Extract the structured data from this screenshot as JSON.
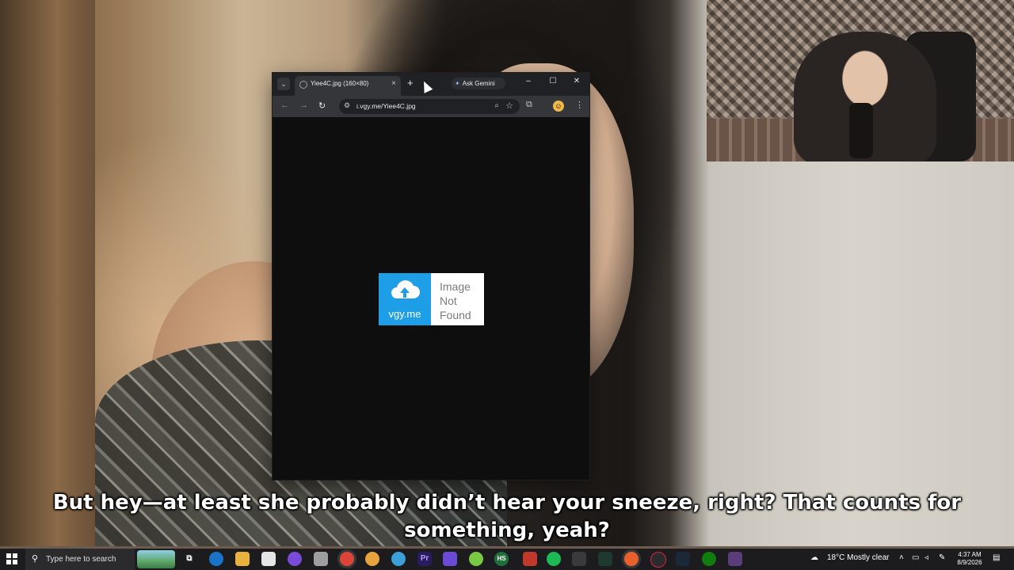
{
  "browser": {
    "tab_title": "Yiee4C.jpg (160×80)",
    "tab_close": "×",
    "new_tab": "+",
    "tab_list": "⌄",
    "ask_gemini": "Ask Gemini",
    "window_controls": {
      "minimize": "–",
      "maximize": "☐",
      "close": "✕"
    },
    "nav": {
      "back": "←",
      "forward": "→",
      "reload": "↻"
    },
    "url": "i.vgy.me/Yiee4C.jpg",
    "icons": [
      "tab-search-icon",
      "globe-icon",
      "site-info-icon",
      "zoom-icon",
      "bookmark-star-icon",
      "extensions-icon",
      "profile-icon",
      "menu-icon"
    ]
  },
  "image_placeholder": {
    "brand": "vgy.me",
    "message": "Image\nNot\nFound",
    "colors": {
      "brand_blue": "#1d9ee6",
      "text_gray": "#7b7b7b"
    }
  },
  "subtitle": {
    "text": "But hey—at least she probably didn’t hear your sneeze, right? That counts for something, yeah?"
  },
  "taskbar": {
    "search_placeholder": "Type here to search",
    "weather": "18°C  Mostly clear",
    "time": "4:37 AM",
    "date": "8/9/2026"
  }
}
